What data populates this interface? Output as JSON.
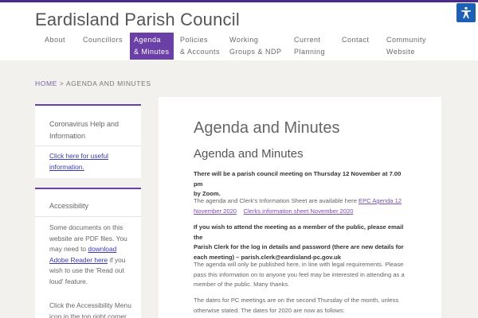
{
  "site": {
    "title": "Eardisland Parish Council"
  },
  "nav": {
    "items": [
      {
        "line1": "About",
        "line2": ""
      },
      {
        "line1": "Councillors",
        "line2": ""
      },
      {
        "line1": "Agenda",
        "line2": "& Minutes"
      },
      {
        "line1": "Policies",
        "line2": "& Accounts"
      },
      {
        "line1": "Working",
        "line2": "Groups & NDP"
      },
      {
        "line1": "Current",
        "line2": "Planning"
      },
      {
        "line1": "Contact",
        "line2": ""
      },
      {
        "line1": "Community",
        "line2": "Website"
      }
    ],
    "active_index": 2
  },
  "accessibility_button": {
    "icon": "accessibility-person-icon",
    "color": "#1d5fb4"
  },
  "breadcrumb": {
    "home": "HOME",
    "separator": ">",
    "current": "AGENDA AND MINUTES"
  },
  "sidebar": {
    "card1": {
      "title_line1": "Coronavirus Help and",
      "title_line2": "Information",
      "link_line1": "Click here for useful",
      "link_line2": "information."
    },
    "card2": {
      "title": "Accessibility",
      "p1_line1": "Some documents on this",
      "p1_line2": "website are PDF files. You",
      "p1_line3_pre": "may need to ",
      "p1_line3_link": "download",
      "p1_line4_link": "Adobe Reader here",
      "p1_line4_post": " if you",
      "p1_line5": "wish to use the 'Read out",
      "p1_line6": "loud' feature.",
      "p2_line1": "Click the Accessibility Menu",
      "p2_line2": "icon in the top right corner"
    }
  },
  "main": {
    "page_title": "Agenda and Minutes",
    "section_title": "Agenda and Minutes",
    "p1_line1": "There will be a parish council meeting on Thursday 12 November at 7.00 pm",
    "p1_line2": "by Zoom.",
    "p2_pre": "The agenda and Clerk's Information Sheet are available here ",
    "p2_link1_a": "EPC Agenda 12",
    "p2_link1_b": "November 2020",
    "p2_link2": "Clerks information sheet November 2020",
    "p3_line1": "If you wish to attend the meeting as a member of the public, please email the",
    "p3_line2": "Parish Clerk for the log in details and password (there are new details for",
    "p3_line3": "each meeting) – parish.clerk@eardisland-pc.gov.uk",
    "p4_line1": "The agenda will only be published here, in line with legal requirements. Please",
    "p4_line2": "pass this information on to anyone you feel may be interested in attending as a",
    "p4_line3": "member of the public. Many thanks.",
    "p5_line1": "The dates for PC meetings are on the second Thursday of the month, unless",
    "p5_line2": "otherwise stated. The dates for 2020 are now as follows:"
  },
  "colors": {
    "accent": "#6a3fa6",
    "topbar": "#4b2c8a",
    "link": "#3a3ab0"
  }
}
